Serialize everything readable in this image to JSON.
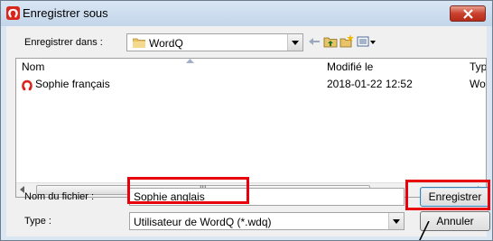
{
  "window": {
    "title": "Enregistrer sous",
    "close_icon": "close-x-icon"
  },
  "colors": {
    "highlight": "#e8000c",
    "logo_red": "#d8261c"
  },
  "toolbar": {
    "savein_label": "Enregistrer dans :",
    "savein_value": "WordQ",
    "icons": [
      "back-arrow-icon",
      "up-folder-icon",
      "new-folder-icon",
      "view-menu-icon"
    ]
  },
  "filelist": {
    "columns": [
      "Nom",
      "Modifié le",
      "Type"
    ],
    "rows": [
      {
        "name": "Sophie français",
        "modified": "2018-01-22 12:52",
        "type": "Wor"
      }
    ],
    "scroll_grip": "III"
  },
  "form": {
    "filename_label": "Nom du fichier :",
    "filename_value": "Sophie anglais",
    "type_label": "Type :",
    "type_value": "Utilisateur de WordQ (*.wdq)"
  },
  "buttons": {
    "save": "Enregistrer",
    "cancel": "Annuler"
  }
}
